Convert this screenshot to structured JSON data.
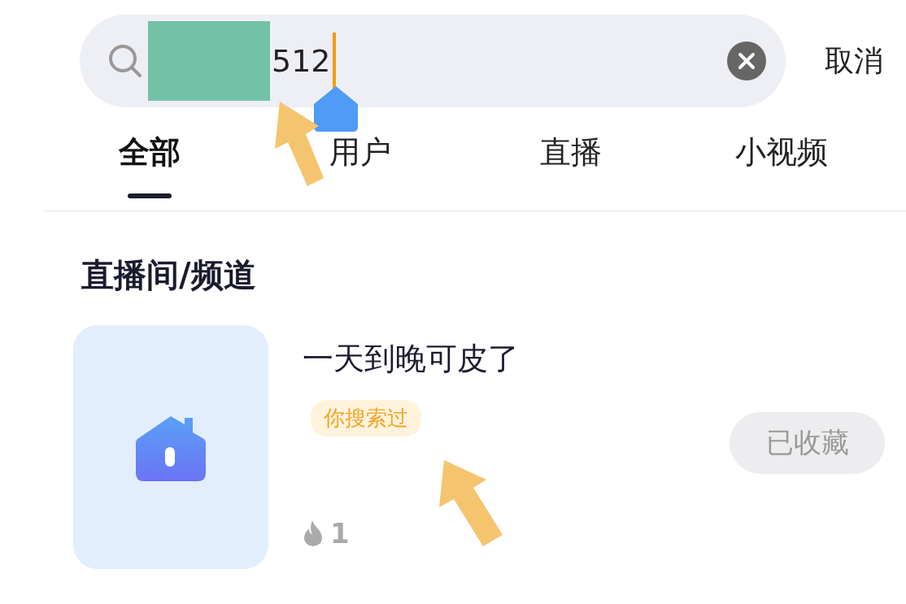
{
  "search": {
    "value": "512"
  },
  "cancel": "取消",
  "tabs": [
    {
      "label": "全部",
      "selected": true
    },
    {
      "label": "用户",
      "selected": false
    },
    {
      "label": "直播",
      "selected": false
    },
    {
      "label": "小视频",
      "selected": false
    }
  ],
  "section_title": "直播间/频道",
  "results": [
    {
      "title": "一天到晚可皮了",
      "badge": "你搜索过",
      "button": "已收藏",
      "favorited": true,
      "heat": "1"
    }
  ]
}
